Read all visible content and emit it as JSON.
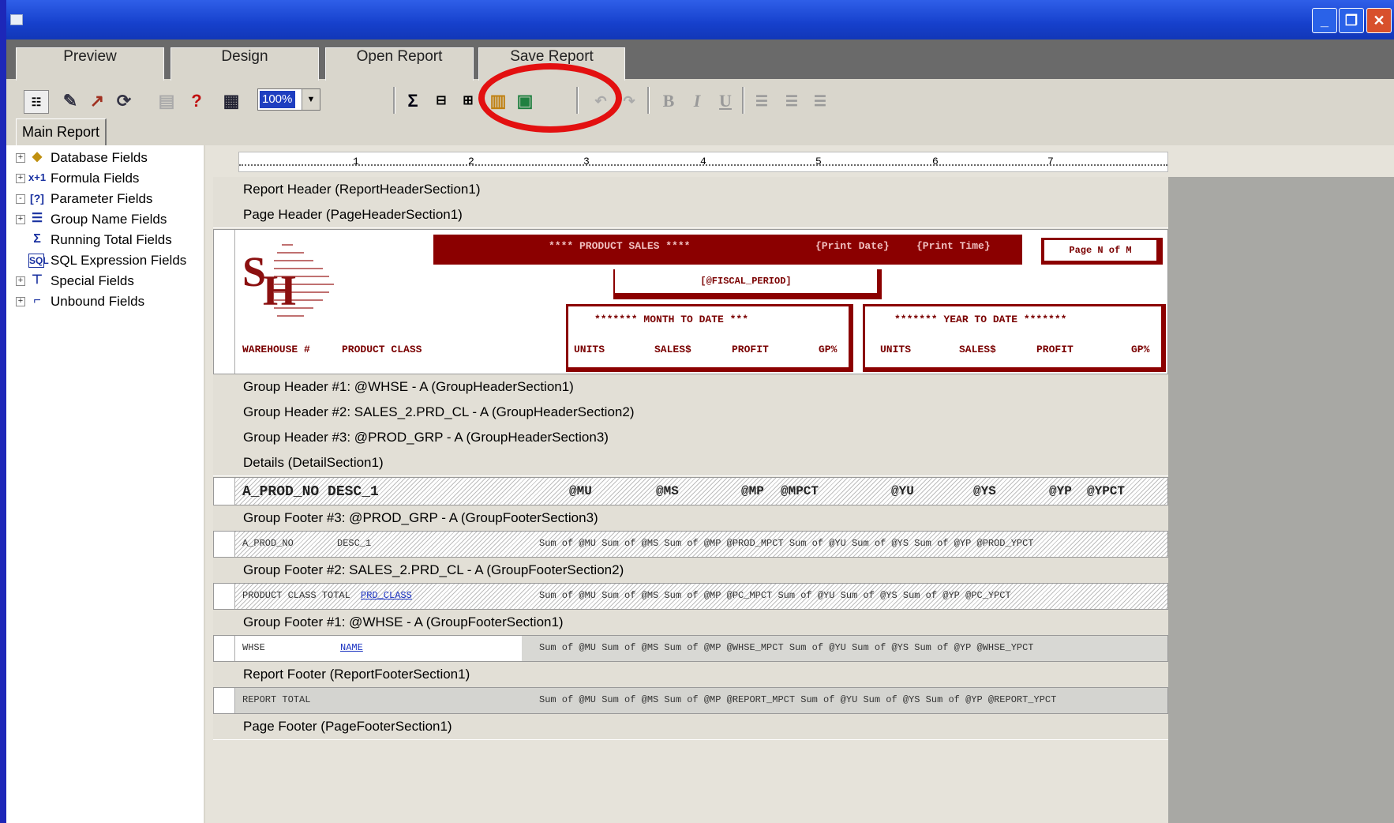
{
  "window": {
    "min_label": "_",
    "max_label": "❐",
    "close_label": "✕"
  },
  "tabs": {
    "preview": "Preview",
    "design": "Design",
    "open": "Open Report",
    "save": "Save Report"
  },
  "toolbar": {
    "zoom": "100%",
    "bold": "B",
    "italic": "I",
    "underline": "U"
  },
  "main_tab": "Main Report",
  "tree": [
    {
      "label": "Database Fields",
      "icon": "database-icon",
      "expander": "+"
    },
    {
      "label": "Formula Fields",
      "icon": "formula-icon",
      "expander": "+"
    },
    {
      "label": "Parameter Fields",
      "icon": "parameter-icon",
      "expander": "-"
    },
    {
      "label": "Group Name Fields",
      "icon": "group-name-icon",
      "expander": "+"
    },
    {
      "label": "Running Total Fields",
      "icon": "running-total-icon",
      "expander": ""
    },
    {
      "label": "SQL Expression Fields",
      "icon": "sql-icon",
      "expander": ""
    },
    {
      "label": "Special Fields",
      "icon": "special-icon",
      "expander": "+"
    },
    {
      "label": "Unbound Fields",
      "icon": "unbound-icon",
      "expander": "+"
    }
  ],
  "ruler": [
    "1",
    "2",
    "3",
    "4",
    "5",
    "6",
    "7"
  ],
  "sections": {
    "report_header": "Report Header (ReportHeaderSection1)",
    "page_header": "Page Header (PageHeaderSection1)",
    "gh1": "Group Header #1: @WHSE - A (GroupHeaderSection1)",
    "gh2": "Group Header #2: SALES_2.PRD_CL - A (GroupHeaderSection2)",
    "gh3": "Group Header #3: @PROD_GRP - A (GroupHeaderSection3)",
    "details": "Details (DetailSection1)",
    "gf3": "Group Footer #3: @PROD_GRP - A (GroupFooterSection3)",
    "gf2": "Group Footer #2: SALES_2.PRD_CL - A (GroupFooterSection2)",
    "gf1": "Group Footer #1: @WHSE - A (GroupFooterSection1)",
    "report_footer": "Report Footer (ReportFooterSection1)",
    "page_footer": "Page Footer (PageFooterSection1)"
  },
  "page_header": {
    "title": "**** PRODUCT SALES ****",
    "print_date": "{Print Date}",
    "print_time": "{Print Time}",
    "page": "Page N of M",
    "fiscal": "[@FISCAL_PERIOD]",
    "mtd": "******* MONTH TO DATE ***",
    "ytd": "******* YEAR TO DATE *******",
    "warehouse": "WAREHOUSE #",
    "prod_class": "PRODUCT CLASS",
    "units": "UNITS",
    "sales": "SALES$",
    "profit": "PROFIT",
    "gp": "GP%"
  },
  "details": [
    "A_PROD_NO DESC_1",
    "@MU",
    "@MS",
    "@MP",
    "@MPCT",
    "@YU",
    "@YS",
    "@YP",
    "@YPCT"
  ],
  "gf3": {
    "left": [
      "A_PROD_NO",
      "DESC_1"
    ],
    "right": "Sum of @MU  Sum of @MS  Sum of @MP  @PROD_MPCT  Sum of @YU  Sum of @YS  Sum of @YP  @PROD_YPCT"
  },
  "gf2": {
    "left": "PRODUCT CLASS TOTAL",
    "link": "PRD_CLASS",
    "right": "Sum of @MU  Sum of @MS  Sum of @MP  @PC_MPCT  Sum of @YU  Sum of @YS  Sum of @YP  @PC_YPCT"
  },
  "gf1": {
    "left": "WHSE",
    "link": "NAME",
    "right": "Sum of @MU  Sum of @MS  Sum of @MP  @WHSE_MPCT  Sum of @YU  Sum of @YS  Sum of @YP  @WHSE_YPCT"
  },
  "rf": {
    "left": "REPORT TOTAL",
    "right": "Sum of @MU  Sum of @MS  Sum of @MP  @REPORT_MPCT  Sum of @YU  Sum of @YS  Sum of @YP  @REPORT_YPCT"
  }
}
